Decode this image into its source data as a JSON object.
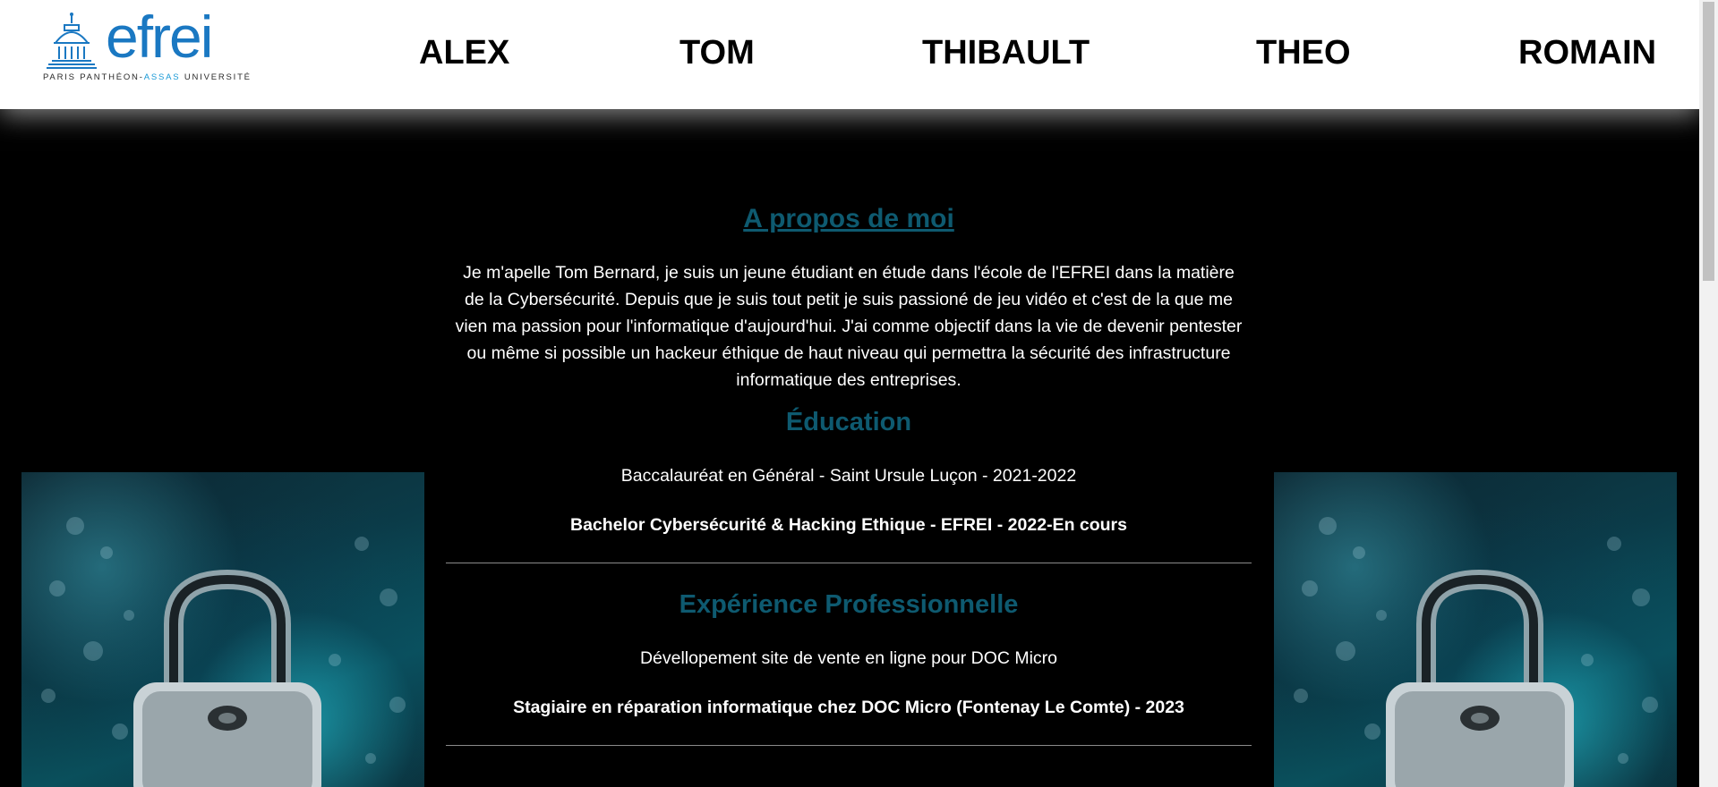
{
  "header": {
    "logo": {
      "wordmark": "efrei",
      "tagline_pre": "PARIS PANTHÉON-",
      "tagline_accent": "ASSAS",
      "tagline_post": " UNIVERSITÉ",
      "brand_color": "#1a78c2",
      "accent_color": "#1a9ad6"
    },
    "nav": [
      {
        "label": "ALEX"
      },
      {
        "label": "TOM"
      },
      {
        "label": "THIBAULT"
      },
      {
        "label": "THEO"
      },
      {
        "label": "ROMAIN"
      }
    ]
  },
  "about": {
    "title": "A propos de moi",
    "text": "Je m'apelle Tom Bernard, je suis un jeune étudiant en étude dans l'école de l'EFREI dans la matière de la Cybersécurité. Depuis que je suis tout petit je suis passioné de jeu vidéo et c'est de la que me vien ma passion pour l'informatique d'aujourd'hui. J'ai comme objectif dans la vie de devenir pentester ou même si possible un hackeur éthique de haut niveau qui permettra la sécurité des infrastructure informatique des entreprises."
  },
  "education": {
    "title": "Éducation",
    "items": [
      "Baccalauréat en Général - Saint Ursule Luçon - 2021-2022",
      "Bachelor Cybersécurité & Hacking Ethique - EFREI - 2022-En cours"
    ]
  },
  "experience": {
    "title": "Expérience Professionnelle",
    "items": [
      "Dévellopement site de vente en ligne pour DOC Micro",
      "Stagiaire en réparation informatique chez DOC Micro (Fontenay Le Comte) - 2023"
    ]
  },
  "colors": {
    "heading": "#0e5a70",
    "background": "#000000",
    "text": "#ffffff"
  },
  "side_images": {
    "icon": "padlock-circuit-image"
  }
}
